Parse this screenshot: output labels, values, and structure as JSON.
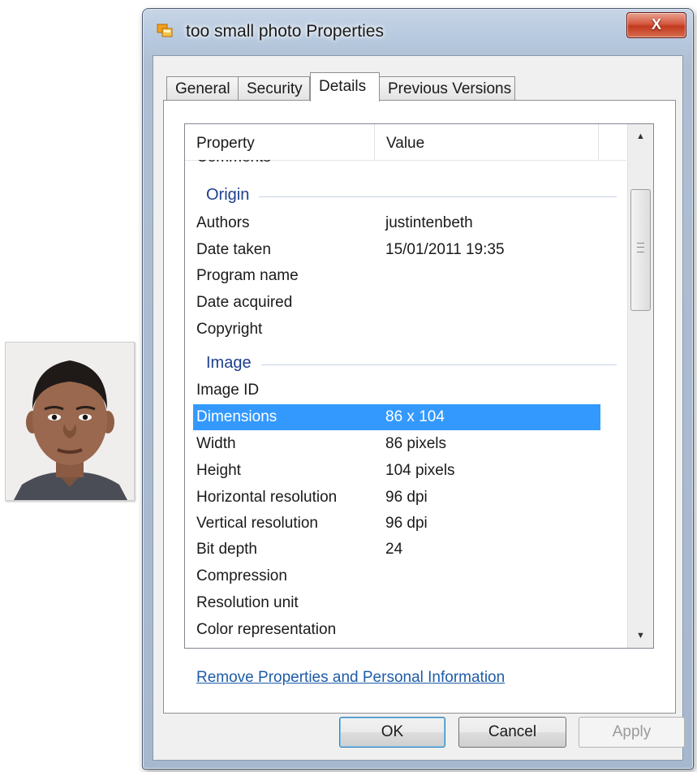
{
  "window": {
    "title": "too small photo Properties",
    "close_label": "X"
  },
  "tabs": [
    {
      "label": "General"
    },
    {
      "label": "Security"
    },
    {
      "label": "Details"
    },
    {
      "label": "Previous Versions"
    }
  ],
  "listview": {
    "headers": {
      "property": "Property",
      "value": "Value"
    },
    "cut_row": "Comments",
    "groups": {
      "origin": "Origin",
      "image": "Image"
    },
    "origin_rows": [
      {
        "key": "Authors",
        "value": "justintenbeth"
      },
      {
        "key": "Date taken",
        "value": "15/01/2011 19:35"
      },
      {
        "key": "Program name",
        "value": ""
      },
      {
        "key": "Date acquired",
        "value": ""
      },
      {
        "key": "Copyright",
        "value": ""
      }
    ],
    "image_rows": [
      {
        "key": "Image ID",
        "value": ""
      },
      {
        "key": "Dimensions",
        "value": "86 x 104"
      },
      {
        "key": "Width",
        "value": "86 pixels"
      },
      {
        "key": "Height",
        "value": "104 pixels"
      },
      {
        "key": "Horizontal resolution",
        "value": "96 dpi"
      },
      {
        "key": "Vertical resolution",
        "value": "96 dpi"
      },
      {
        "key": "Bit depth",
        "value": "24"
      },
      {
        "key": "Compression",
        "value": ""
      },
      {
        "key": "Resolution unit",
        "value": ""
      },
      {
        "key": "Color representation",
        "value": ""
      }
    ]
  },
  "link": "Remove Properties and Personal Information",
  "buttons": {
    "ok": "OK",
    "cancel": "Cancel",
    "apply": "Apply"
  },
  "colors": {
    "selection": "#3399ff",
    "group_header": "#1e3f8e",
    "link": "#1f5ca8"
  }
}
